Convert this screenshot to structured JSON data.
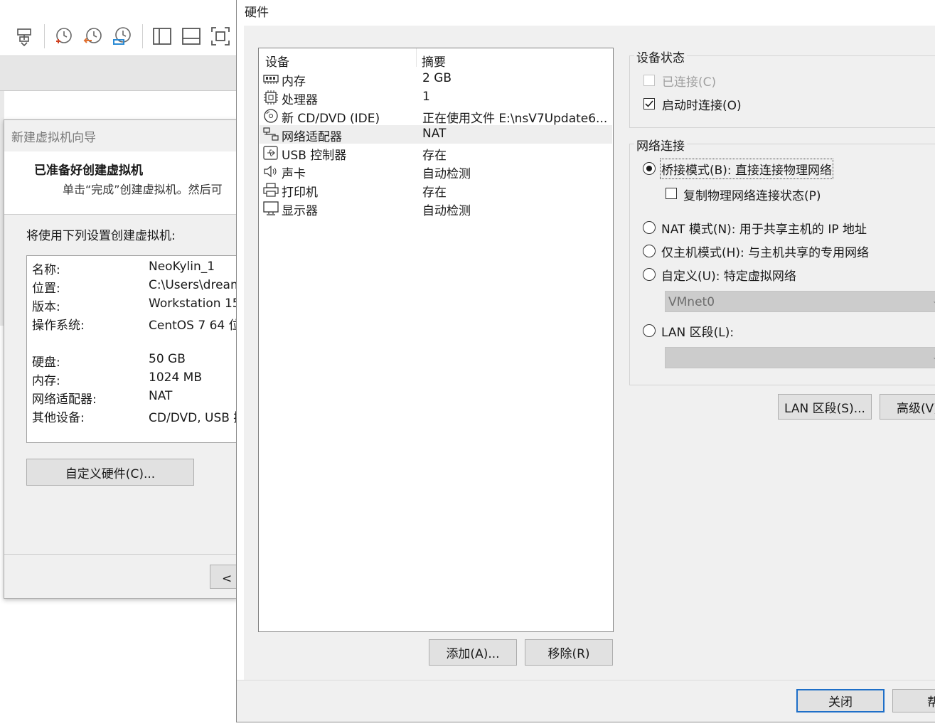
{
  "background_app": {
    "toolbar_icons": [
      "send-to-icon",
      "snapshot-take-icon",
      "snapshot-revert-icon",
      "snapshot-manager-icon",
      "sidebar-view-icon",
      "console-view-icon",
      "fullscreen-icon"
    ]
  },
  "wizard": {
    "title": "新建虚拟机向导",
    "heading": "已准备好创建虚拟机",
    "subtext": "单击“完成”创建虚拟机。然后可",
    "intro": "将使用下列设置创建虚拟机:",
    "settings": [
      {
        "key": "名称:",
        "value": "NeoKylin_1"
      },
      {
        "key": "位置:",
        "value": "C:\\Users\\dream"
      },
      {
        "key": "版本:",
        "value": "Workstation 15."
      },
      {
        "key": "操作系统:",
        "value": "CentOS 7 64 位"
      },
      {
        "key": "硬盘:",
        "value": "50 GB"
      },
      {
        "key": "内存:",
        "value": "1024 MB"
      },
      {
        "key": "网络适配器:",
        "value": "NAT"
      },
      {
        "key": "其他设备:",
        "value": "CD/DVD, USB 控"
      }
    ],
    "customize_button": "自定义硬件(C)...",
    "back_button": "< 上"
  },
  "hardware": {
    "title": "硬件",
    "columns": {
      "device": "设备",
      "summary": "摘要"
    },
    "devices": [
      {
        "icon": "memory-icon",
        "name": "内存",
        "summary": "2 GB",
        "selected": false
      },
      {
        "icon": "processor-icon",
        "name": "处理器",
        "summary": "1",
        "selected": false
      },
      {
        "icon": "cd-dvd-icon",
        "name": "新 CD/DVD (IDE)",
        "summary": "正在使用文件 E:\\nsV7Update6...",
        "selected": false
      },
      {
        "icon": "network-adapter-icon",
        "name": "网络适配器",
        "summary": "NAT",
        "selected": true
      },
      {
        "icon": "usb-controller-icon",
        "name": "USB 控制器",
        "summary": "存在",
        "selected": false
      },
      {
        "icon": "sound-card-icon",
        "name": "声卡",
        "summary": "自动检测",
        "selected": false
      },
      {
        "icon": "printer-icon",
        "name": "打印机",
        "summary": "存在",
        "selected": false
      },
      {
        "icon": "display-icon",
        "name": "显示器",
        "summary": "自动检测",
        "selected": false
      }
    ],
    "add_button": "添加(A)...",
    "remove_button": "移除(R)",
    "device_status": {
      "title": "设备状态",
      "connected_label": "已连接(C)",
      "connected_checked": false,
      "connected_enabled": false,
      "connect_on_power_label": "启动时连接(O)",
      "connect_on_power_checked": true
    },
    "network": {
      "title": "网络连接",
      "bridged_label": "桥接模式(B): 直接连接物理网络",
      "replicate_label": "复制物理网络连接状态(P)",
      "nat_label": "NAT 模式(N): 用于共享主机的 IP 地址",
      "hostonly_label": "仅主机模式(H): 与主机共享的专用网络",
      "custom_label": "自定义(U): 特定虚拟网络",
      "custom_value": "VMnet0",
      "lan_label": "LAN 区段(L):",
      "lan_value": "",
      "selected": "bridged"
    },
    "lan_segments_button": "LAN 区段(S)...",
    "advanced_button": "高级(V)",
    "close_button": "关闭",
    "help_button": "帮助"
  }
}
